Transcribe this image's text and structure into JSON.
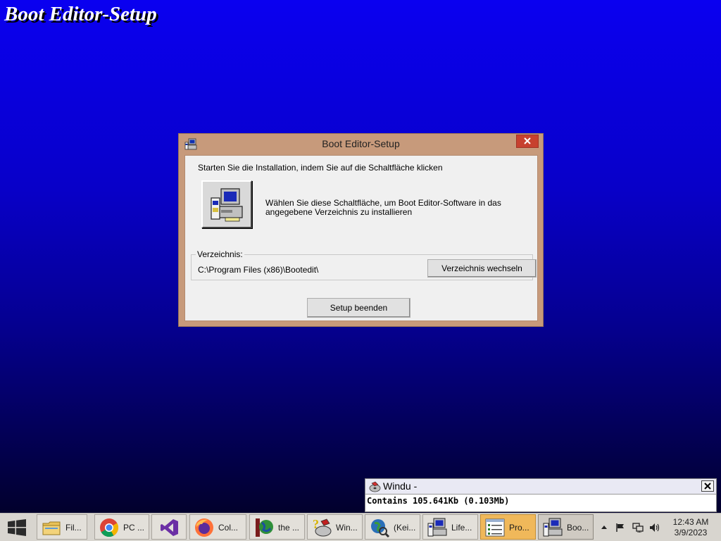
{
  "desktop": {
    "banner_title": "Boot Editor-Setup"
  },
  "dialog": {
    "title": "Boot Editor-Setup",
    "instruction": "Starten Sie die Installation, indem Sie auf die Schaltfläche klicken",
    "install_description": "Wählen Sie diese Schaltfläche, um Boot Editor-Software in das angegebene Verzeichnis zu installieren",
    "directory_label": "Verzeichnis:",
    "directory_path": "C:\\Program Files (x86)\\Bootedit\\",
    "change_directory_label": "Verzeichnis wechseln",
    "exit_label": "Setup beenden",
    "close_color": "#c7412f"
  },
  "windu": {
    "title": "Windu -",
    "text": "Contains 105.641Kb (0.103Mb)"
  },
  "taskbar": {
    "items": [
      {
        "label": "Fil...",
        "icon": "folder-icon"
      },
      {
        "label": "PC ...",
        "icon": "chrome-icon"
      },
      {
        "label": "",
        "icon": "visual-studio-icon"
      },
      {
        "label": "Col...",
        "icon": "firefox-icon"
      },
      {
        "label": "the ...",
        "icon": "globe-icon"
      },
      {
        "label": "Win...",
        "icon": "help-disk-icon"
      },
      {
        "label": "(Kei...",
        "icon": "search-globe-icon"
      },
      {
        "label": "Life...",
        "icon": "setup-computer-icon"
      },
      {
        "label": "Pro...",
        "icon": "list-window-icon"
      },
      {
        "label": "Boo...",
        "icon": "setup-computer-icon"
      }
    ],
    "clock_time": "12:43 AM",
    "clock_date": "3/9/2023",
    "active_color": "#f0b85a"
  }
}
